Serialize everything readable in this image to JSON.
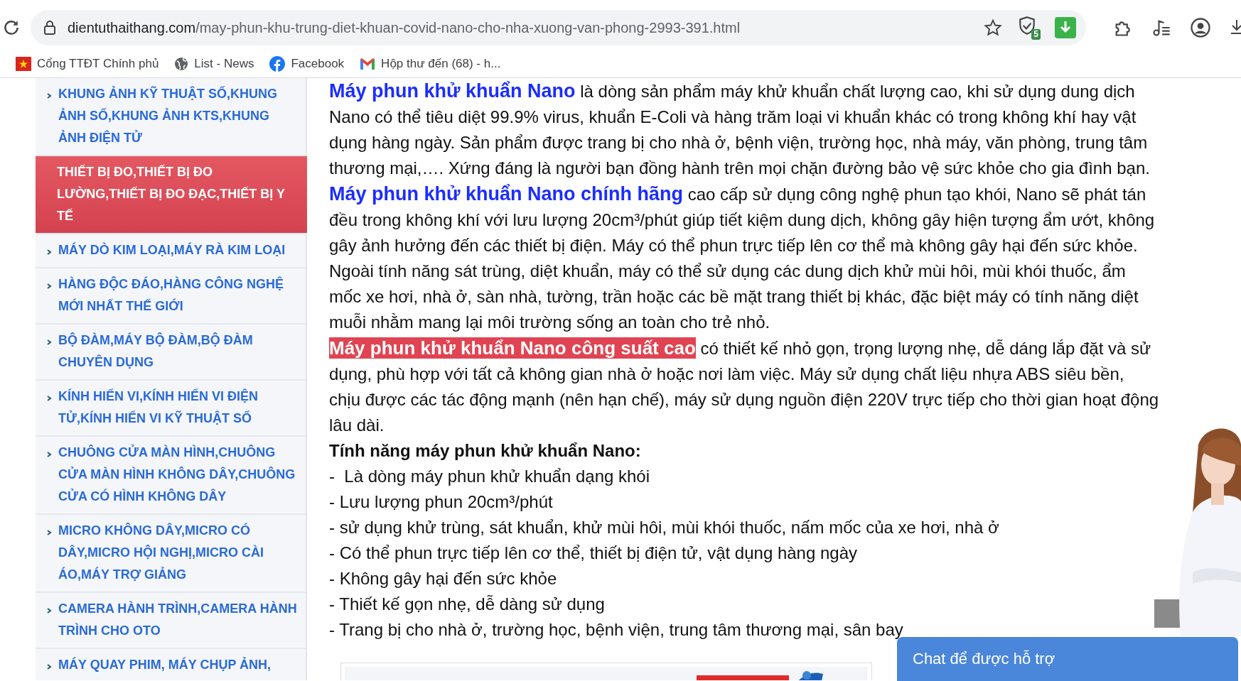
{
  "browser": {
    "url_domain": "dientuthaithang.com",
    "url_path": "/may-phun-khu-trung-diet-khuan-covid-nano-cho-nha-xuong-van-phong-2993-391.html",
    "extension_badge": "5",
    "bookmarks": [
      {
        "label": "Cổng TTĐT Chính phủ",
        "kind": "flag"
      },
      {
        "label": "List - News",
        "kind": "globe"
      },
      {
        "label": "Facebook",
        "kind": "facebook"
      },
      {
        "label": "Hộp thư đến (68) - h...",
        "kind": "mail"
      }
    ]
  },
  "sidebar": {
    "items": [
      {
        "label": "KHUNG ẢNH KỸ THUẬT SỐ,KHUNG ẢNH SỐ,KHUNG ẢNH KTS,KHUNG ẢNH ĐIỆN TỬ",
        "selected": false
      },
      {
        "label": "THIẾT BỊ ĐO,THIẾT BỊ ĐO LƯỜNG,THIẾT BỊ ĐO ĐẠC,THIẾT BỊ Y TẾ",
        "selected": true
      },
      {
        "label": "MÁY DÒ KIM LOẠI,MÁY RÀ KIM LOẠI",
        "selected": false
      },
      {
        "label": "HÀNG ĐỘC ĐÁO,HÀNG CÔNG NGHỆ MỚI NHẤT THẾ GIỚI",
        "selected": false
      },
      {
        "label": "BỘ ĐÀM,MÁY BỘ ĐÀM,BỘ ĐÀM CHUYÊN DỤNG",
        "selected": false
      },
      {
        "label": "KÍNH HIỂN VI,KÍNH HIỂN VI ĐIỆN TỬ,KÍNH HIỂN VI KỸ THUẬT SỐ",
        "selected": false
      },
      {
        "label": "CHUÔNG CỬA MÀN HÌNH,CHUÔNG CỬA MÀN HÌNH KHÔNG DÂY,CHUÔNG CỬA CÓ HÌNH KHÔNG DÂY",
        "selected": false
      },
      {
        "label": "MICRO KHÔNG DÂY,MICRO CÓ DÂY,MICRO HỘI NGHỊ,MICRO CÀI ÁO,MÁY TRỢ GIẢNG",
        "selected": false
      },
      {
        "label": "CAMERA HÀNH TRÌNH,CAMERA HÀNH TRÌNH CHO OTO",
        "selected": false
      },
      {
        "label": "MÁY QUAY PHIM, MÁY CHỤP ẢNH,",
        "selected": false
      }
    ]
  },
  "article": {
    "paragraphs": [
      {
        "lead": "Máy phun khử khuẩn Nano",
        "kind": "link",
        "text": " là dòng sản phẩm máy khử khuẩn chất lượng cao, khi sử dụng dung dịch Nano có thể tiêu diệt 99.9% virus, khuẩn E-Coli và hàng trăm loại vi khuẩn khác có trong không khí hay vật dụng hàng ngày. Sản phẩm được trang bị cho nhà ở, bệnh viện, trường học, nhà máy, văn phòng, trung tâm thương mại,…. Xứng đáng là người bạn đồng hành trên mọi chặn đường bảo vệ sức khỏe cho gia đình bạn."
      },
      {
        "lead": "Máy phun khử khuẩn Nano chính hãng",
        "kind": "link",
        "text": " cao cấp sử dụng công nghệ phun tạo khói, Nano sẽ phát tán đều trong không khí với lưu lượng 20cm³/phút giúp tiết kiệm dung dịch, không gây hiện tượng ẩm ướt, không gây ảnh hưởng đến các thiết bị điện. Máy có thể phun trực tiếp lên cơ thể mà không gây hại đến sức khỏe. Ngoài tính năng sát trùng, diệt khuẩn, máy có thể sử dụng các dung dịch khử mùi hôi, mùi khói thuốc, ẩm mốc xe hơi, nhà ở, sàn nhà, tường, trần hoặc các bề mặt trang thiết bị khác, đặc biệt máy có tính năng diệt muỗi nhằm mang lại môi trường sống an toàn cho trẻ nhỏ."
      },
      {
        "lead": "Máy phun khử khuẩn Nano công suất cao",
        "kind": "highlight",
        "text": " có thiết kế nhỏ gọn, trọng lượng nhẹ, dễ dáng lắp đặt và sử dụng, phù hợp với tất cả không gian nhà ở hoặc nơi làm việc. Máy sử dụng chất liệu nhựa ABS siêu bền, chịu được các tác động mạnh (nên hạn chế), máy sử dụng nguồn điện 220V trực tiếp cho thời gian hoạt động lâu dài."
      }
    ],
    "features_title": "Tính năng máy phun khử khuẩn Nano:",
    "features": [
      "-  Là dòng máy phun khử khuẩn dạng khói",
      "- Lưu lượng phun 20cm³/phút",
      "- sử dụng khử trùng, sát khuẩn, khử mùi hôi, mùi khói thuốc, nấm mốc của xe hơi, nhà ở",
      "- Có thể phun trực tiếp lên cơ thể, thiết bị điện tử, vật dụng hàng ngày",
      "- Không gây hại đến sức khỏe",
      "- Thiết kế gọn nhẹ, dễ dàng sử dụng",
      "- Trang bị cho nhà ở, trường học, bệnh viện, trung tâm thương mại, sân bay"
    ]
  },
  "chat": {
    "label": "Chat để được hỗ trợ"
  }
}
